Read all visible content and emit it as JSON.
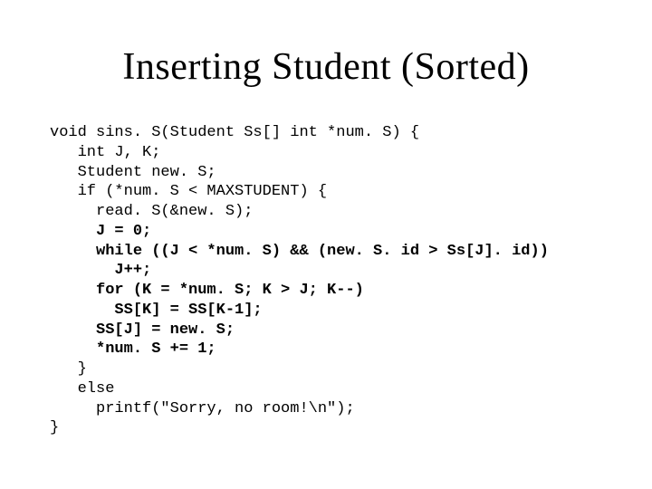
{
  "slide": {
    "title": "Inserting Student (Sorted)",
    "code": {
      "l1": "void sins. S(Student Ss[] int *num. S) {",
      "l2": "   int J, K;",
      "l3": "   Student new. S;",
      "l4": "   if (*num. S < MAXSTUDENT) {",
      "l5": "     read. S(&new. S);",
      "l6": "     J = 0;",
      "l7": "     while ((J < *num. S) && (new. S. id > Ss[J]. id))",
      "l8": "       J++;",
      "l9": "     for (K = *num. S; K > J; K--)",
      "l10": "       SS[K] = SS[K-1];",
      "l11": "     SS[J] = new. S;",
      "l12": "     *num. S += 1;",
      "l13": "   }",
      "l14": "   else",
      "l15": "     printf(\"Sorry, no room!\\n\");",
      "l16": "}"
    }
  }
}
